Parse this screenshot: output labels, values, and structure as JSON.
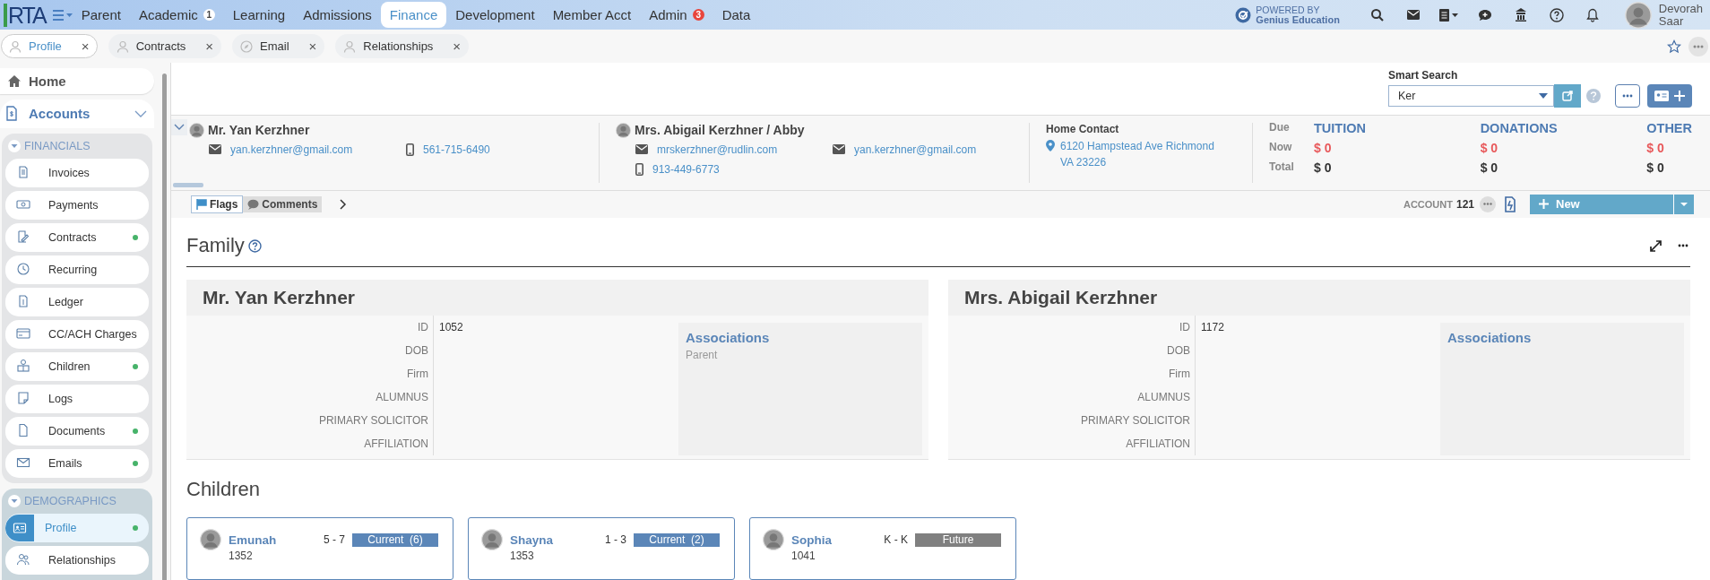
{
  "nav": {
    "logo": "RTA",
    "menu_items": [
      {
        "label": "Parent",
        "selected": false
      },
      {
        "label": "Academic",
        "badge": {
          "text": "1",
          "color": "#ffffff"
        },
        "selected": false
      },
      {
        "label": "Learning",
        "selected": false
      },
      {
        "label": "Admissions",
        "selected": false
      },
      {
        "label": "Finance",
        "selected": true
      },
      {
        "label": "Development",
        "selected": false
      },
      {
        "label": "Member Acct",
        "selected": false
      },
      {
        "label": "Admin",
        "badge": {
          "text": "3",
          "color": "#e8453c"
        },
        "selected": false
      },
      {
        "label": "Data",
        "selected": false
      }
    ],
    "powered_by": [
      "POWERED BY",
      "Genius Education"
    ],
    "user": [
      "Devorah",
      "Saar"
    ]
  },
  "tabs": [
    {
      "label": "Profile",
      "close": "×",
      "selected": true
    },
    {
      "label": "Contracts",
      "close": "×",
      "selected": false
    },
    {
      "label": "Email",
      "close": "×",
      "selected": false
    },
    {
      "label": "Relationships",
      "close": "×",
      "selected": false
    }
  ],
  "sidebar": {
    "home": "Home",
    "accounts": "Accounts",
    "sections": [
      {
        "title": "FINANCIALS",
        "expanded": true,
        "items": [
          {
            "label": "Invoices",
            "dot": false,
            "selected": false
          },
          {
            "label": "Payments",
            "dot": false,
            "selected": false
          },
          {
            "label": "Contracts",
            "dot": true,
            "selected": false
          },
          {
            "label": "Recurring",
            "dot": false,
            "selected": false
          },
          {
            "label": "Ledger",
            "dot": false,
            "selected": false
          },
          {
            "label": "CC/ACH Charges",
            "dot": false,
            "selected": false
          },
          {
            "label": "Children",
            "dot": true,
            "selected": false
          },
          {
            "label": "Logs",
            "dot": false,
            "selected": false
          },
          {
            "label": "Documents",
            "dot": true,
            "selected": false
          },
          {
            "label": "Emails",
            "dot": true,
            "selected": false
          }
        ]
      },
      {
        "title": "DEMOGRAPHICS",
        "expanded": true,
        "items": [
          {
            "label": "Profile",
            "dot": true,
            "selected": true
          },
          {
            "label": "Relationships",
            "dot": false,
            "selected": false
          }
        ]
      }
    ]
  },
  "smart_search": {
    "label": "Smart Search",
    "value": "Ker"
  },
  "header": {
    "contacts": [
      {
        "name": "Mr. Yan Kerzhner",
        "fields": [
          {
            "kind": "email",
            "value": "yan.kerzhner@gmail.com"
          },
          {
            "kind": "phone",
            "value": "561-715-6490"
          }
        ]
      },
      {
        "name": "Mrs. Abigail Kerzhner / Abby",
        "fields": [
          {
            "kind": "email",
            "value": "mrskerzhner@rudlin.com"
          },
          {
            "kind": "email",
            "value": "yan.kerzhner@gmail.com"
          },
          {
            "kind": "phone",
            "value": "913-449-6773"
          }
        ]
      }
    ],
    "home_contact": {
      "label": "Home Contact",
      "address": [
        "6120 Hampstead Ave Richmond",
        "VA 23226"
      ]
    },
    "balances": {
      "row_labels": [
        "Due",
        "Now",
        "Total"
      ],
      "columns": [
        {
          "title": "TUITION",
          "now": "$ 0",
          "total": "$ 0"
        },
        {
          "title": "DONATIONS",
          "now": "$ 0",
          "total": "$ 0"
        },
        {
          "title": "OTHER",
          "now": "$ 0",
          "total": "$ 0"
        }
      ]
    },
    "note_tabs": [
      {
        "label": "Flags",
        "selected": true
      },
      {
        "label": "Comments",
        "selected": false
      }
    ],
    "account": {
      "label": "ACCOUNT",
      "number": "121"
    },
    "new_button": "New"
  },
  "family": {
    "title": "Family",
    "parents": [
      {
        "name": "Mr. Yan Kerzhner",
        "fields": [
          {
            "label": "ID",
            "value": "1052"
          },
          {
            "label": "DOB"
          },
          {
            "label": "Firm"
          },
          {
            "label": "ALUMNUS"
          },
          {
            "label": "PRIMARY SOLICITOR"
          },
          {
            "label": "AFFILIATION"
          }
        ],
        "associations": {
          "title": "Associations",
          "items": [
            "Parent"
          ]
        }
      },
      {
        "name": "Mrs. Abigail Kerzhner",
        "fields": [
          {
            "label": "ID",
            "value": "1172"
          },
          {
            "label": "DOB"
          },
          {
            "label": "Firm"
          },
          {
            "label": "ALUMNUS"
          },
          {
            "label": "PRIMARY SOLICITOR"
          },
          {
            "label": "AFFILIATION"
          }
        ],
        "associations": {
          "title": "Associations"
        }
      }
    ]
  },
  "children": {
    "title": "Children",
    "cards": [
      {
        "name": "Emunah",
        "grades": "5 - 7",
        "status": "Current  (6)",
        "color": "#5b86b8",
        "id": "1352"
      },
      {
        "name": "Shayna",
        "grades": "1 - 3",
        "status": "Current  (2)",
        "color": "#5b86b8",
        "id": "1353"
      },
      {
        "name": "Sophia",
        "grades": "K - K",
        "status": "Future",
        "color": "#808080",
        "id": "1041"
      }
    ]
  }
}
